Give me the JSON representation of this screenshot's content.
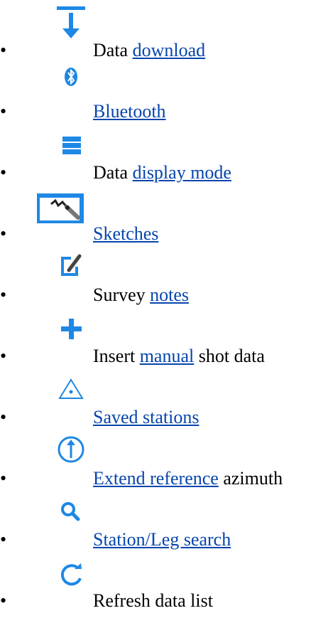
{
  "items": [
    {
      "icon": "download-icon",
      "pre": "Data ",
      "link": "download",
      "post": ""
    },
    {
      "icon": "bluetooth-icon",
      "pre": "",
      "link": "Bluetooth",
      "post": ""
    },
    {
      "icon": "list-display-icon",
      "pre": "Data ",
      "link": "display mode",
      "post": ""
    },
    {
      "icon": "sketch-icon",
      "pre": "",
      "link": "Sketches",
      "post": ""
    },
    {
      "icon": "notes-icon",
      "pre": "Survey ",
      "link": "notes",
      "post": ""
    },
    {
      "icon": "plus-icon",
      "pre": "Insert ",
      "link": "manual",
      "post": " shot data"
    },
    {
      "icon": "station-icon",
      "pre": "",
      "link": "Saved stations",
      "post": ""
    },
    {
      "icon": "azimuth-icon",
      "pre": "",
      "link": "Extend reference",
      "post": " azimuth"
    },
    {
      "icon": "search-icon",
      "pre": "",
      "link": "Station/Leg search",
      "post": ""
    },
    {
      "icon": "refresh-icon",
      "pre": "Refresh data list",
      "link": "",
      "post": ""
    }
  ],
  "colors": {
    "icon_blue": "#1e88e5",
    "link": "#0645ad",
    "text": "#000000"
  }
}
